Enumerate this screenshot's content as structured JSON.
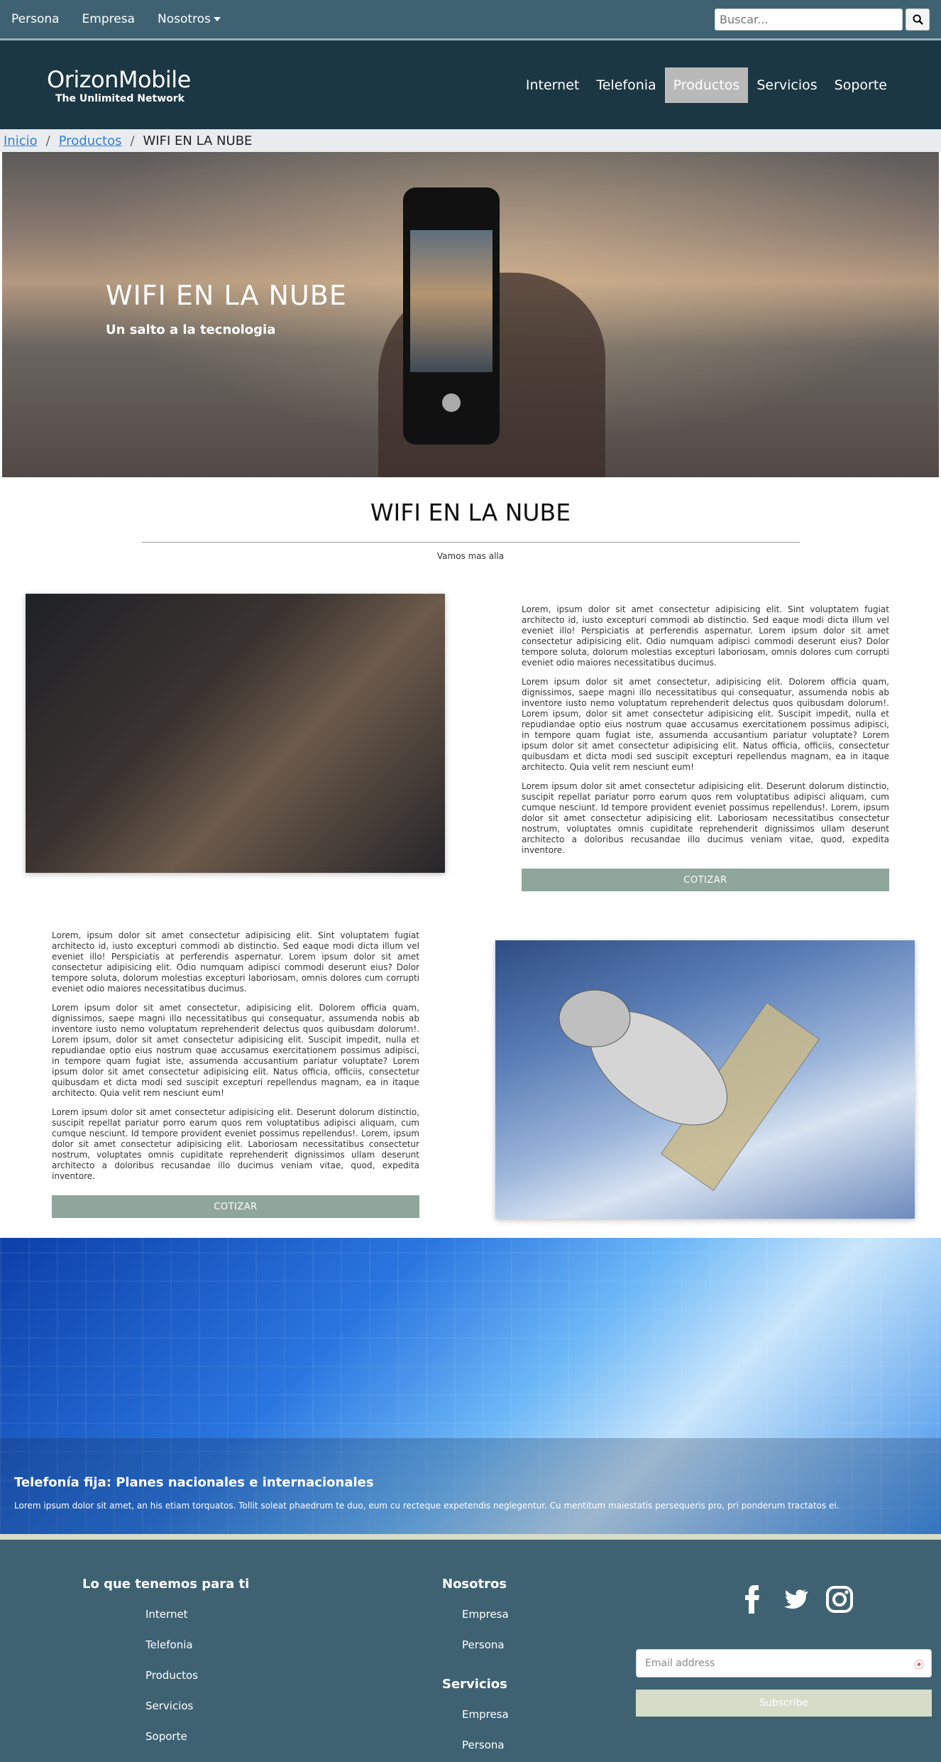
{
  "topbar": {
    "links": [
      "Persona",
      "Empresa",
      "Nosotros"
    ],
    "search_placeholder": "Buscar..."
  },
  "header": {
    "brand": "OrizonMobile",
    "tagline": "The Unlimited Network",
    "nav": [
      "Internet",
      "Telefonia",
      "Productos",
      "Servicios",
      "Soporte"
    ]
  },
  "breadcrumb": {
    "home": "Inicio",
    "products": "Productos",
    "current": "WIFI EN LA NUBE"
  },
  "hero": {
    "title": "WIFI EN LA NUBE",
    "subtitle": "Un salto a la tecnologia"
  },
  "section": {
    "title": "WIFI EN LA NUBE",
    "subtitle": "Vamos mas alla"
  },
  "block1": {
    "p1": "Lorem, ipsum dolor sit amet consectetur adipisicing elit. Sint voluptatem fugiat architecto id, iusto excepturi commodi ab distinctio. Sed eaque modi dicta illum vel eveniet illo! Perspiciatis at perferendis aspernatur. Lorem ipsum dolor sit amet consectetur adipisicing elit. Odio numquam adipisci commodi deserunt eius? Dolor tempore soluta, dolorum molestias excepturi laboriosam, omnis dolores cum corrupti eveniet odio maiores necessitatibus ducimus.",
    "p2": "Lorem ipsum dolor sit amet consectetur, adipisicing elit. Dolorem officia quam, dignissimos, saepe magni illo necessitatibus qui consequatur, assumenda nobis ab inventore iusto nemo voluptatum reprehenderit delectus quos quibusdam dolorum!. Lorem ipsum, dolor sit amet consectetur adipisicing elit. Suscipit impedit, nulla et repudiandae optio eius nostrum quae accusamus exercitationem possimus adipisci, in tempore quam fugiat iste, assumenda accusantium pariatur voluptate? Lorem ipsum dolor sit amet consectetur adipisicing elit. Natus officia, officiis, consectetur quibusdam et dicta modi sed suscipit excepturi repellendus magnam, ea in itaque architecto. Quia velit rem nesciunt eum!",
    "p3": "Lorem ipsum dolor sit amet consectetur adipisicing elit. Deserunt dolorum distinctio, suscipit repellat pariatur porro earum quos rem voluptatibus adipisci aliquam, cum cumque nesciunt. Id tempore provident eveniet possimus repellendus!. Lorem, ipsum dolor sit amet consectetur adipisicing elit. Laboriosam necessitatibus consectetur nostrum, voluptates omnis cupiditate reprehenderit dignissimos ullam deserunt architecto a doloribus recusandae illo ducimus veniam vitae, quod, expedita inventore.",
    "button": "COTIZAR"
  },
  "block2": {
    "p1": "Lorem, ipsum dolor sit amet consectetur adipisicing elit. Sint voluptatem fugiat architecto id, iusto excepturi commodi ab distinctio. Sed eaque modi dicta illum vel eveniet illo! Perspiciatis at perferendis aspernatur. Lorem ipsum dolor sit amet consectetur adipisicing elit. Odio numquam adipisci commodi deserunt eius? Dolor tempore soluta, dolorum molestias excepturi laboriosam, omnis dolores cum corrupti eveniet odio maiores necessitatibus ducimus.",
    "p2": "Lorem ipsum dolor sit amet consectetur, adipisicing elit. Dolorem officia quam, dignissimos, saepe magni illo necessitatibus qui consequatur, assumenda nobis ab inventore iusto nemo voluptatum reprehenderit delectus quos quibusdam dolorum!. Lorem ipsum, dolor sit amet consectetur adipisicing elit. Suscipit impedit, nulla et repudiandae optio eius nostrum quae accusamus exercitationem possimus adipisci, in tempore quam fugiat iste, assumenda accusantium pariatur voluptate? Lorem ipsum dolor sit amet consectetur adipisicing elit. Natus officia, officiis, consectetur quibusdam et dicta modi sed suscipit excepturi repellendus magnam, ea in itaque architecto. Quia velit rem nesciunt eum!",
    "p3": "Lorem ipsum dolor sit amet consectetur adipisicing elit. Deserunt dolorum distinctio, suscipit repellat pariatur porro earum quos rem voluptatibus adipisci aliquam, cum cumque nesciunt. Id tempore provident eveniet possimus repellendus!. Lorem, ipsum dolor sit amet consectetur adipisicing elit. Laboriosam necessitatibus consectetur nostrum, voluptates omnis cupiditate reprehenderit dignissimos ullam deserunt architecto a doloribus recusandae illo ducimus veniam vitae, quod, expedita inventore.",
    "button": "COTIZAR"
  },
  "banner": {
    "title": "Telefonía fija: Planes nacionales e internacionales",
    "text": "Lorem ipsum dolor sit amet, an his etiam torquatos. Tollit soleat phaedrum te duo, eum cu recteque expetendis neglegentur. Cu mentitum maiestatis persequeris pro, pri ponderum tractatos ei."
  },
  "footer": {
    "col1_title": "Lo que tenemos para ti",
    "col1_links": [
      "Internet",
      "Telefonia",
      "Productos",
      "Servicios",
      "Soporte"
    ],
    "col2_title": "Nosotros",
    "col2_links": [
      "Empresa",
      "Persona"
    ],
    "col3_title": "Servicios",
    "col3_links": [
      "Empresa",
      "Persona"
    ],
    "email_placeholder": "Email address",
    "subscribe": "Subscribe",
    "social": [
      "facebook-icon",
      "twitter-icon",
      "instagram-icon"
    ]
  },
  "colors": {
    "topbar": "#3f6272",
    "header": "#1c3744",
    "button": "#8fa69a",
    "footer": "#3f6272",
    "subscribe": "#d6dcc8"
  }
}
